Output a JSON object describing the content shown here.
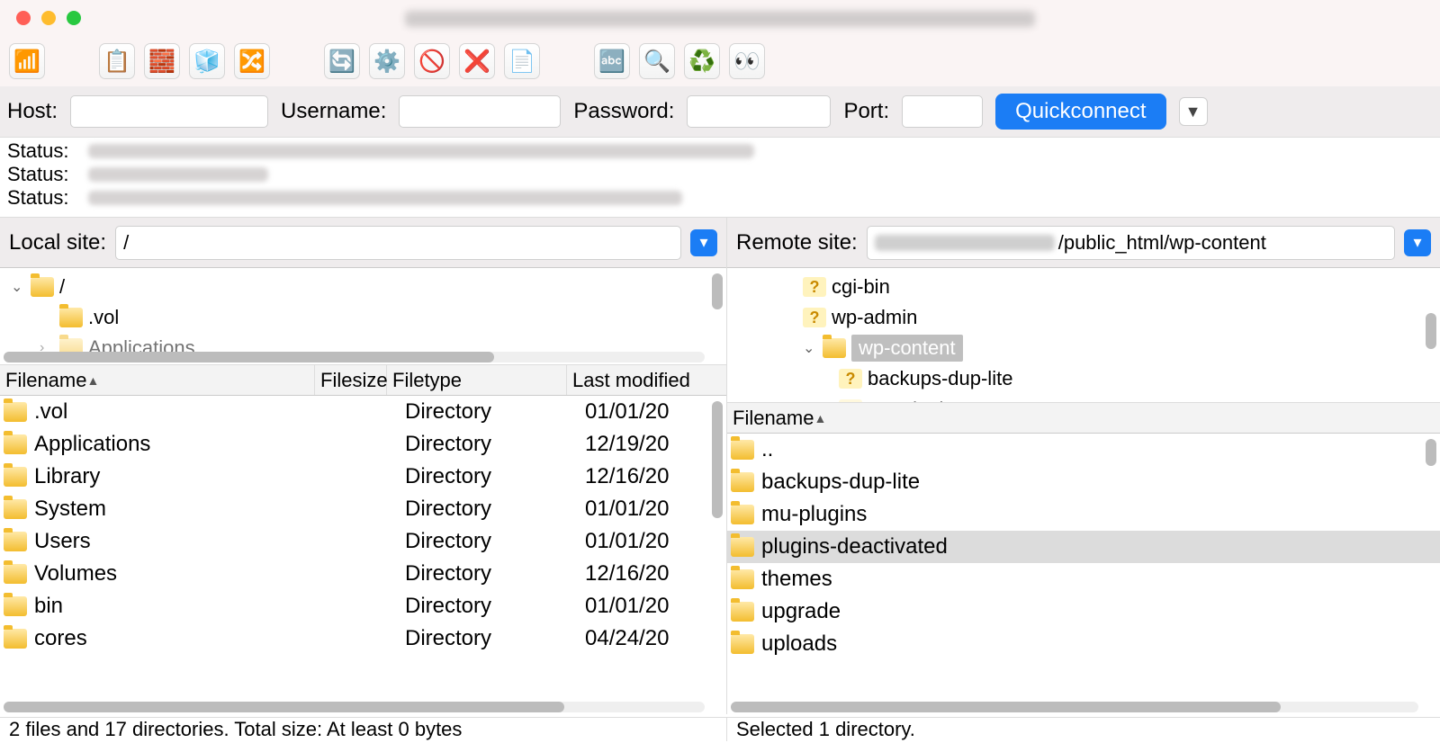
{
  "quickconnect": {
    "host_label": "Host:",
    "user_label": "Username:",
    "pass_label": "Password:",
    "port_label": "Port:",
    "button": "Quickconnect",
    "host": "",
    "user": "",
    "pass": "",
    "port": ""
  },
  "log": {
    "label": "Status:"
  },
  "local": {
    "site_label": "Local site:",
    "site_value": "/",
    "tree": {
      "root": "/",
      "items": [
        ".vol",
        "Applications"
      ]
    },
    "columns": [
      "Filename",
      "Filesize",
      "Filetype",
      "Last modified"
    ],
    "rows": [
      {
        "name": ".vol",
        "type": "Directory",
        "date": "01/01/20"
      },
      {
        "name": "Applications",
        "type": "Directory",
        "date": "12/19/20"
      },
      {
        "name": "Library",
        "type": "Directory",
        "date": "12/16/20"
      },
      {
        "name": "System",
        "type": "Directory",
        "date": "01/01/20"
      },
      {
        "name": "Users",
        "type": "Directory",
        "date": "01/01/20"
      },
      {
        "name": "Volumes",
        "type": "Directory",
        "date": "12/16/20"
      },
      {
        "name": "bin",
        "type": "Directory",
        "date": "01/01/20"
      },
      {
        "name": "cores",
        "type": "Directory",
        "date": "04/24/20"
      }
    ],
    "status": "2 files and 17 directories. Total size: At least 0 bytes"
  },
  "remote": {
    "site_label": "Remote site:",
    "site_suffix": "/public_html/wp-content",
    "tree": {
      "items": [
        "cgi-bin",
        "wp-admin",
        "wp-content",
        "backups-dup-lite",
        "mu-plugins"
      ]
    },
    "columns": [
      "Filename"
    ],
    "rows": [
      {
        "name": ".."
      },
      {
        "name": "backups-dup-lite"
      },
      {
        "name": "mu-plugins"
      },
      {
        "name": "plugins-deactivated",
        "selected": true
      },
      {
        "name": "themes"
      },
      {
        "name": "upgrade"
      },
      {
        "name": "uploads"
      }
    ],
    "status": "Selected 1 directory."
  }
}
